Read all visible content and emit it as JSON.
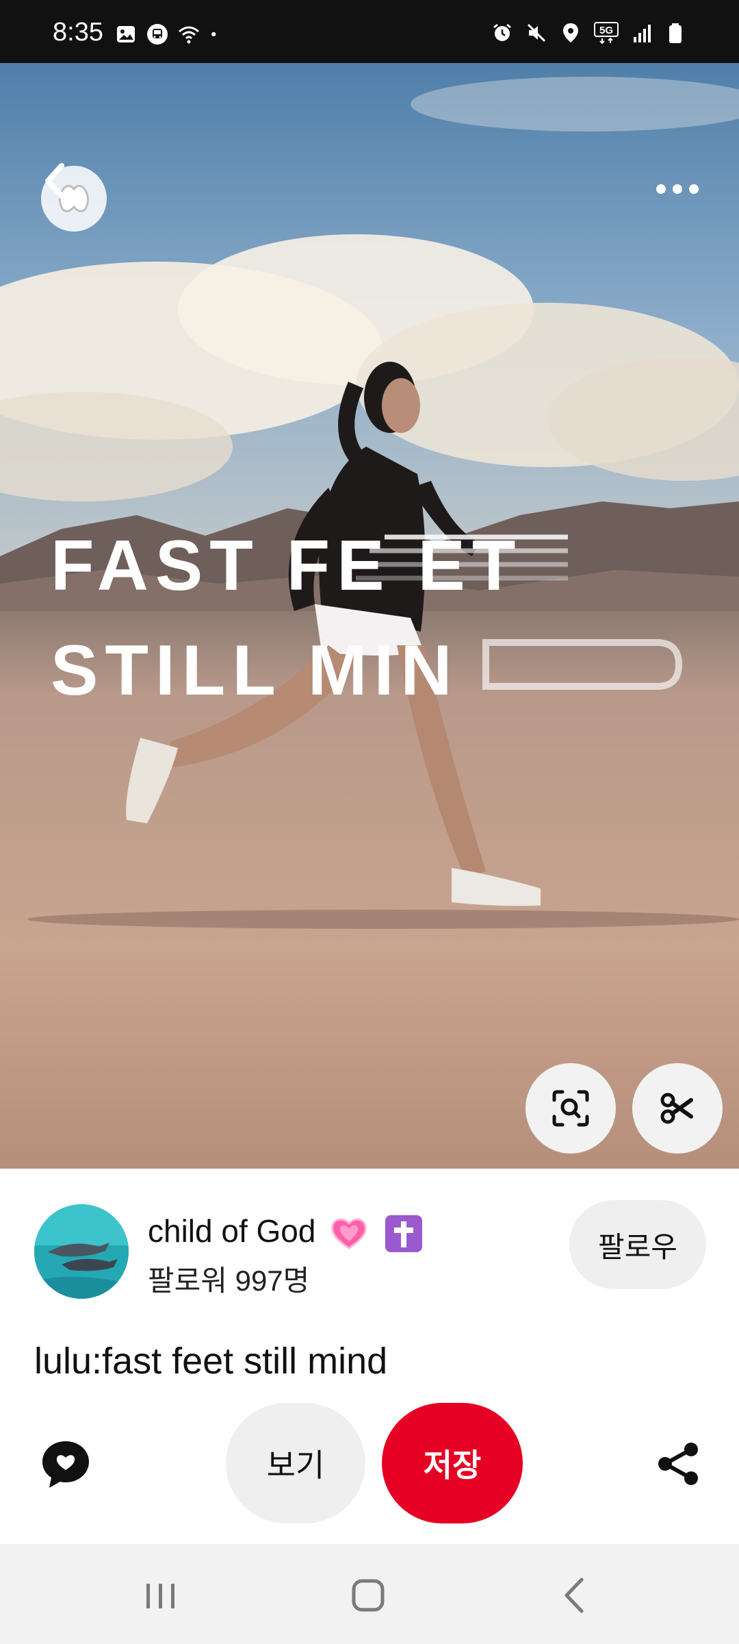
{
  "status_bar": {
    "time": "8:35",
    "left_icons": [
      "gallery-icon",
      "bus-icon",
      "wifi-icon",
      "dot-icon"
    ],
    "right_icons": [
      "alarm-icon",
      "mute-icon",
      "location-icon",
      "5g-icon",
      "signal-icon",
      "battery-icon"
    ],
    "network_label": "5G"
  },
  "hero": {
    "headline_line1": "FAST FE ET",
    "headline_line2": "STILL MIN",
    "logo_icon": "lululemon-logo-icon",
    "back_icon": "back-arrow-icon",
    "more_icon": "more-icon",
    "visual_search_icon": "visual-search-icon",
    "cut_icon": "scissors-icon"
  },
  "creator": {
    "name": "child of God",
    "followers": "팔로워 997명",
    "follow_label": "팔로우",
    "emojis": [
      "heart-icon",
      "latin-cross-icon"
    ]
  },
  "pin": {
    "title": "lulu:fast feet still mind"
  },
  "actions": {
    "view_label": "보기",
    "save_label": "저장",
    "comment_icon": "comment-icon",
    "share_icon": "share-icon"
  },
  "colors": {
    "save_red": "#e60023",
    "pill_gray": "#efefef"
  },
  "nav": {
    "buttons": [
      "recents-icon",
      "home-icon",
      "back-icon"
    ]
  }
}
